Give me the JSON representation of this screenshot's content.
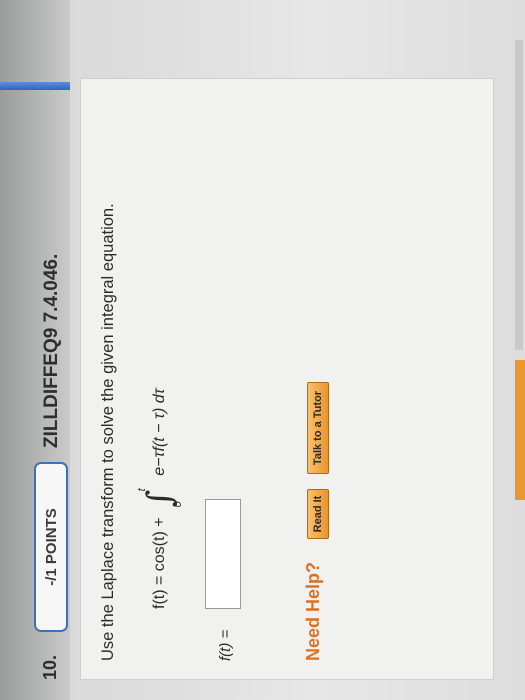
{
  "question": {
    "number": "10.",
    "points": "-/1 POINTS",
    "id": "ZILLDIFFEQ9 7.4.046."
  },
  "problem": {
    "instruction": "Use the Laplace transform to solve the given integral equation.",
    "equation_lhs": "f(t) = cos(t) +",
    "integral_upper": "t",
    "integral_lower": "0",
    "integrand": "e−τf(t − τ) dτ"
  },
  "answer": {
    "label": "f(t) =",
    "value": ""
  },
  "help": {
    "label": "Need Help?",
    "read_it": "Read It",
    "talk_to_tutor": "Talk to a Tutor"
  }
}
